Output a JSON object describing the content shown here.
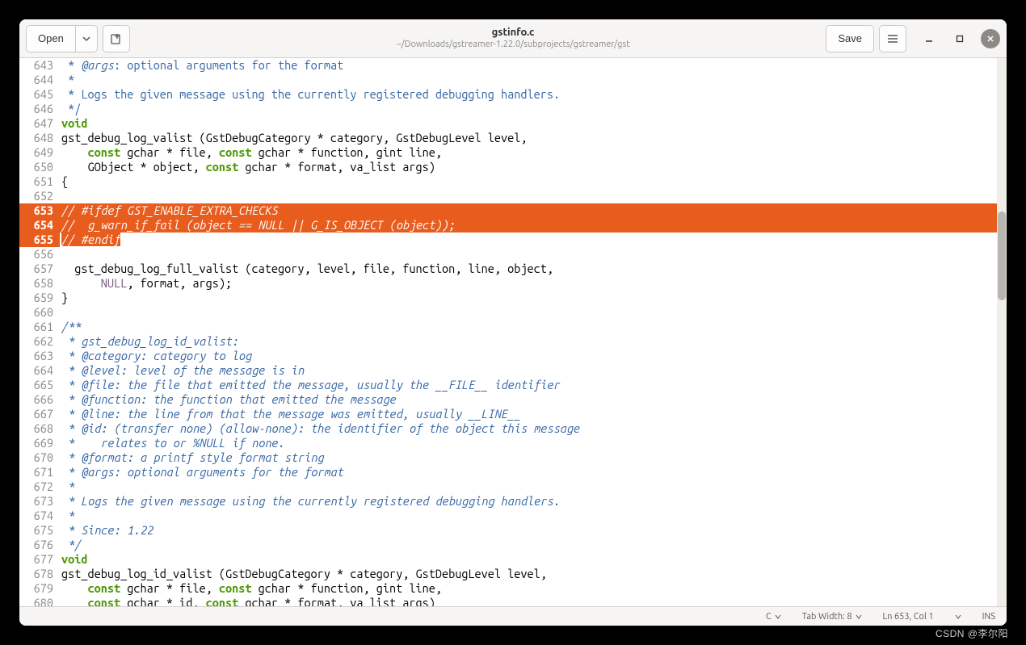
{
  "header": {
    "open_label": "Open",
    "save_label": "Save",
    "title": "gstinfo.c",
    "subtitle": "~/Downloads/gstreamer-1.22.0/subprojects/gstreamer/gst"
  },
  "status": {
    "language": "C",
    "tabwidth": "Tab Width: 8",
    "cursor": "Ln 653, Col 1",
    "ins": "INS"
  },
  "watermark": "CSDN @李尔阳",
  "lines": [
    {
      "n": 643,
      "hl": false,
      "segs": [
        {
          "c": "c-comment",
          "t": " * "
        },
        {
          "c": "c-comment-arg",
          "t": "@args"
        },
        {
          "c": "c-comment",
          "t": ": optional arguments for the format"
        }
      ]
    },
    {
      "n": 644,
      "hl": false,
      "segs": [
        {
          "c": "c-comment",
          "t": " *"
        }
      ]
    },
    {
      "n": 645,
      "hl": false,
      "segs": [
        {
          "c": "c-comment",
          "t": " * Logs the given message using the currently registered debugging handlers."
        }
      ]
    },
    {
      "n": 646,
      "hl": false,
      "segs": [
        {
          "c": "c-comment",
          "t": " */"
        }
      ]
    },
    {
      "n": 647,
      "hl": false,
      "segs": [
        {
          "c": "c-kw",
          "t": "void"
        }
      ]
    },
    {
      "n": 648,
      "hl": false,
      "segs": [
        {
          "c": "c-plain",
          "t": "gst_debug_log_valist (GstDebugCategory * category, GstDebugLevel level,"
        }
      ]
    },
    {
      "n": 649,
      "hl": false,
      "segs": [
        {
          "c": "c-plain",
          "t": "    "
        },
        {
          "c": "c-kw",
          "t": "const"
        },
        {
          "c": "c-plain",
          "t": " gchar * file, "
        },
        {
          "c": "c-kw",
          "t": "const"
        },
        {
          "c": "c-plain",
          "t": " gchar * function, gint line,"
        }
      ]
    },
    {
      "n": 650,
      "hl": false,
      "segs": [
        {
          "c": "c-plain",
          "t": "    GObject * object, "
        },
        {
          "c": "c-kw",
          "t": "const"
        },
        {
          "c": "c-plain",
          "t": " gchar * format, va_list args)"
        }
      ]
    },
    {
      "n": 651,
      "hl": false,
      "segs": [
        {
          "c": "c-plain",
          "t": "{"
        }
      ]
    },
    {
      "n": 652,
      "hl": false,
      "segs": []
    },
    {
      "n": 653,
      "hl": true,
      "segs": [
        {
          "c": "hlspan",
          "t": "// #ifdef GST_ENABLE_EXTRA_CHECKS"
        }
      ]
    },
    {
      "n": 654,
      "hl": true,
      "segs": [
        {
          "c": "hlspan",
          "t": "//  g_warn_if_fail (object == NULL || G_IS_OBJECT (object));"
        }
      ]
    },
    {
      "n": 655,
      "hl": "partial",
      "segs": [
        {
          "c": "hlspan",
          "t": "// #endif"
        }
      ]
    },
    {
      "n": 656,
      "hl": false,
      "segs": []
    },
    {
      "n": 657,
      "hl": false,
      "segs": [
        {
          "c": "c-plain",
          "t": "  gst_debug_log_full_valist (category, level, file, function, line, object,"
        }
      ]
    },
    {
      "n": 658,
      "hl": false,
      "segs": [
        {
          "c": "c-plain",
          "t": "      "
        },
        {
          "c": "c-null",
          "t": "NULL"
        },
        {
          "c": "c-plain",
          "t": ", format, args);"
        }
      ]
    },
    {
      "n": 659,
      "hl": false,
      "segs": [
        {
          "c": "c-plain",
          "t": "}"
        }
      ]
    },
    {
      "n": 660,
      "hl": false,
      "segs": []
    },
    {
      "n": 661,
      "hl": false,
      "segs": [
        {
          "c": "c-comment-italic",
          "t": "/**"
        }
      ]
    },
    {
      "n": 662,
      "hl": false,
      "segs": [
        {
          "c": "c-comment-italic",
          "t": " * gst_debug_log_id_valist:"
        }
      ]
    },
    {
      "n": 663,
      "hl": false,
      "segs": [
        {
          "c": "c-comment-italic",
          "t": " * "
        },
        {
          "c": "c-comment-arg",
          "t": "@category"
        },
        {
          "c": "c-comment-italic",
          "t": ": category to log"
        }
      ]
    },
    {
      "n": 664,
      "hl": false,
      "segs": [
        {
          "c": "c-comment-italic",
          "t": " * "
        },
        {
          "c": "c-comment-arg",
          "t": "@level"
        },
        {
          "c": "c-comment-italic",
          "t": ": level of the message is in"
        }
      ]
    },
    {
      "n": 665,
      "hl": false,
      "segs": [
        {
          "c": "c-comment-italic",
          "t": " * "
        },
        {
          "c": "c-comment-arg",
          "t": "@file"
        },
        {
          "c": "c-comment-italic",
          "t": ": the file that emitted the message, usually the __FILE__ identifier"
        }
      ]
    },
    {
      "n": 666,
      "hl": false,
      "segs": [
        {
          "c": "c-comment-italic",
          "t": " * "
        },
        {
          "c": "c-comment-arg",
          "t": "@function"
        },
        {
          "c": "c-comment-italic",
          "t": ": the function that emitted the message"
        }
      ]
    },
    {
      "n": 667,
      "hl": false,
      "segs": [
        {
          "c": "c-comment-italic",
          "t": " * "
        },
        {
          "c": "c-comment-arg",
          "t": "@line"
        },
        {
          "c": "c-comment-italic",
          "t": ": the line from that the message was emitted, usually __LINE__"
        }
      ]
    },
    {
      "n": 668,
      "hl": false,
      "segs": [
        {
          "c": "c-comment-italic",
          "t": " * "
        },
        {
          "c": "c-comment-arg",
          "t": "@id"
        },
        {
          "c": "c-comment-italic",
          "t": ": (transfer none) (allow-none): the identifier of the object this message"
        }
      ]
    },
    {
      "n": 669,
      "hl": false,
      "segs": [
        {
          "c": "c-comment-italic",
          "t": " *    relates to or "
        },
        {
          "c": "c-comment-arg",
          "t": "%NULL"
        },
        {
          "c": "c-comment-italic",
          "t": " if none."
        }
      ]
    },
    {
      "n": 670,
      "hl": false,
      "segs": [
        {
          "c": "c-comment-italic",
          "t": " * "
        },
        {
          "c": "c-comment-arg",
          "t": "@format"
        },
        {
          "c": "c-comment-italic",
          "t": ": a printf style format string"
        }
      ]
    },
    {
      "n": 671,
      "hl": false,
      "segs": [
        {
          "c": "c-comment-italic",
          "t": " * "
        },
        {
          "c": "c-comment-arg",
          "t": "@args"
        },
        {
          "c": "c-comment-italic",
          "t": ": optional arguments for the format"
        }
      ]
    },
    {
      "n": 672,
      "hl": false,
      "segs": [
        {
          "c": "c-comment-italic",
          "t": " *"
        }
      ]
    },
    {
      "n": 673,
      "hl": false,
      "segs": [
        {
          "c": "c-comment-italic",
          "t": " * Logs the given message using the currently registered debugging handlers."
        }
      ]
    },
    {
      "n": 674,
      "hl": false,
      "segs": [
        {
          "c": "c-comment-italic",
          "t": " *"
        }
      ]
    },
    {
      "n": 675,
      "hl": false,
      "segs": [
        {
          "c": "c-comment-italic",
          "t": " * Since: 1.22"
        }
      ]
    },
    {
      "n": 676,
      "hl": false,
      "segs": [
        {
          "c": "c-comment-italic",
          "t": " */"
        }
      ]
    },
    {
      "n": 677,
      "hl": false,
      "segs": [
        {
          "c": "c-kw",
          "t": "void"
        }
      ]
    },
    {
      "n": 678,
      "hl": false,
      "segs": [
        {
          "c": "c-plain",
          "t": "gst_debug_log_id_valist (GstDebugCategory * category, GstDebugLevel level,"
        }
      ]
    },
    {
      "n": 679,
      "hl": false,
      "segs": [
        {
          "c": "c-plain",
          "t": "    "
        },
        {
          "c": "c-kw",
          "t": "const"
        },
        {
          "c": "c-plain",
          "t": " gchar * file, "
        },
        {
          "c": "c-kw",
          "t": "const"
        },
        {
          "c": "c-plain",
          "t": " gchar * function, gint line,"
        }
      ]
    },
    {
      "n": 680,
      "hl": false,
      "segs": [
        {
          "c": "c-plain",
          "t": "    "
        },
        {
          "c": "c-kw",
          "t": "const"
        },
        {
          "c": "c-plain",
          "t": " gchar * id, "
        },
        {
          "c": "c-kw",
          "t": "const"
        },
        {
          "c": "c-plain",
          "t": " gchar * format, va_list args)"
        }
      ]
    }
  ]
}
